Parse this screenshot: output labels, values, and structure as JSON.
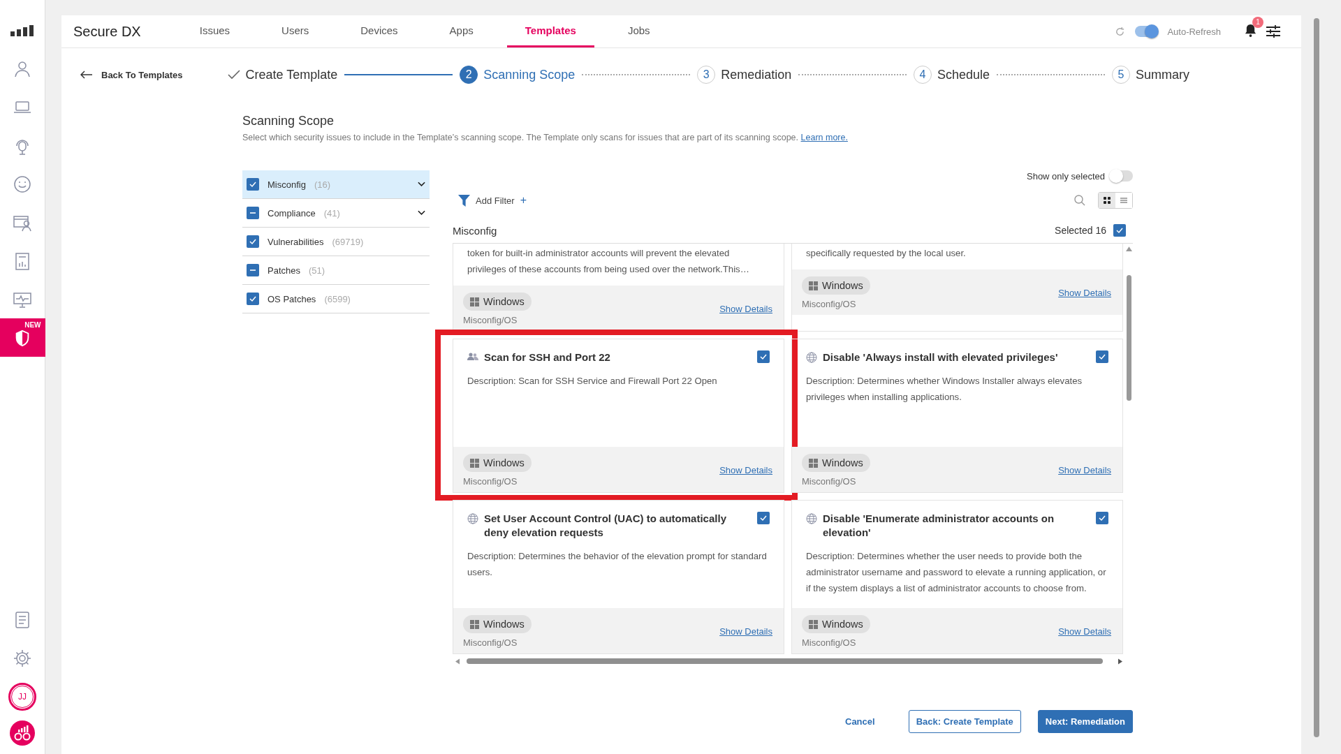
{
  "sidebar": {
    "items": [
      {
        "kind": "signal",
        "selected": false
      },
      {
        "kind": "person",
        "selected": false
      },
      {
        "kind": "laptop",
        "selected": false
      },
      {
        "kind": "headset",
        "selected": false
      },
      {
        "kind": "smiley",
        "selected": false
      },
      {
        "kind": "browser-user",
        "selected": false
      },
      {
        "kind": "report",
        "selected": false
      },
      {
        "kind": "monitor",
        "selected": false
      },
      {
        "kind": "shield",
        "selected": true,
        "badge": "NEW"
      }
    ],
    "bottom_items": [
      {
        "kind": "list"
      },
      {
        "kind": "gear"
      }
    ],
    "avatar": "JJ"
  },
  "nav": {
    "brand": "Secure DX",
    "tabs": [
      {
        "label": "Issues",
        "selected": false
      },
      {
        "label": "Users",
        "selected": false
      },
      {
        "label": "Devices",
        "selected": false
      },
      {
        "label": "Apps",
        "selected": false
      },
      {
        "label": "Templates",
        "selected": true
      },
      {
        "label": "Jobs",
        "selected": false
      }
    ],
    "auto_refresh": {
      "label": "Auto-Refresh",
      "on": true
    },
    "notifications": {
      "count": "1"
    }
  },
  "stepper": {
    "back": "Back To Templates",
    "steps": [
      {
        "label": "Create Template",
        "completed": true,
        "selected": false
      },
      {
        "number": "2",
        "label": "Scanning Scope",
        "completed": false,
        "selected": true
      },
      {
        "number": "3",
        "label": "Remediation",
        "completed": false,
        "selected": false
      },
      {
        "number": "4",
        "label": "Schedule",
        "completed": false,
        "selected": false
      },
      {
        "number": "5",
        "label": "Summary",
        "completed": false,
        "selected": false
      }
    ]
  },
  "section": {
    "title": "Scanning Scope",
    "description": "Select which security issues to include in the Template’s scanning scope. The Template only scans for issues that are part of its scanning scope.",
    "link": "Learn more."
  },
  "categories": [
    {
      "name": "Misconfig",
      "count": "(16)",
      "checked": true,
      "partial": false,
      "selected": true,
      "expandable": true
    },
    {
      "name": "Compliance",
      "count": "(41)",
      "checked": true,
      "partial": true,
      "selected": false,
      "expandable": true
    },
    {
      "name": "Vulnerabilities",
      "count": "(69719)",
      "checked": true,
      "partial": false,
      "selected": false,
      "expandable": false
    },
    {
      "name": "Patches",
      "count": "(51)",
      "checked": true,
      "partial": true,
      "selected": false,
      "expandable": false
    },
    {
      "name": "OS Patches",
      "count": "(6599)",
      "checked": true,
      "partial": false,
      "selected": false,
      "expandable": false
    }
  ],
  "show_only_selected": {
    "label": "Show only selected",
    "on": false
  },
  "add_filter": {
    "label": "Add Filter",
    "icon": "+"
  },
  "view_modes": [
    {
      "kind": "grid",
      "selected": true
    },
    {
      "kind": "list",
      "selected": false
    }
  ],
  "group": {
    "title": "Misconfig",
    "selected_label": "Selected 16",
    "checked": true
  },
  "cards": [
    {
      "kind": "partial",
      "description": "token for built-in administrator accounts will prevent the elevated privileges of these accounts from being used over the network.This…",
      "platform": "Windows",
      "category": "Misconfig/OS",
      "link": "Show Details"
    },
    {
      "kind": "partial",
      "description": "specifically requested by the local user.",
      "platform": "Windows",
      "category": "Misconfig/OS",
      "link": "Show Details"
    },
    {
      "kind": "group",
      "title": "Scan for SSH and Port 22",
      "checked": true,
      "highlighted": true,
      "description": "Description: Scan for SSH Service and Firewall Port 22 Open",
      "platform": "Windows",
      "category": "Misconfig/OS",
      "link": "Show Details"
    },
    {
      "kind": "policy",
      "title": "Disable 'Always install with elevated privileges'",
      "checked": true,
      "highlighted": false,
      "description": "Description: Determines whether Windows Installer always elevates privileges when installing applications.",
      "platform": "Windows",
      "category": "Misconfig/OS",
      "link": "Show Details"
    },
    {
      "kind": "policy",
      "title": "Set User Account Control (UAC) to automatically deny elevation requests",
      "checked": true,
      "highlighted": false,
      "description": "Description: Determines the behavior of the elevation prompt for standard users.",
      "platform": "Windows",
      "category": "Misconfig/OS",
      "link": "Show Details"
    },
    {
      "kind": "policy",
      "title": "Disable 'Enumerate administrator accounts on elevation'",
      "checked": true,
      "highlighted": false,
      "description": "Description: Determines whether the user needs to provide both the administrator username and password to elevate a running application, or if the system displays a list of administrator accounts to choose from.",
      "platform": "Windows",
      "category": "Misconfig/OS",
      "link": "Show Details"
    }
  ],
  "actions": {
    "cancel": "Cancel",
    "back": "Back: Create Template",
    "next": "Next: Remediation"
  }
}
